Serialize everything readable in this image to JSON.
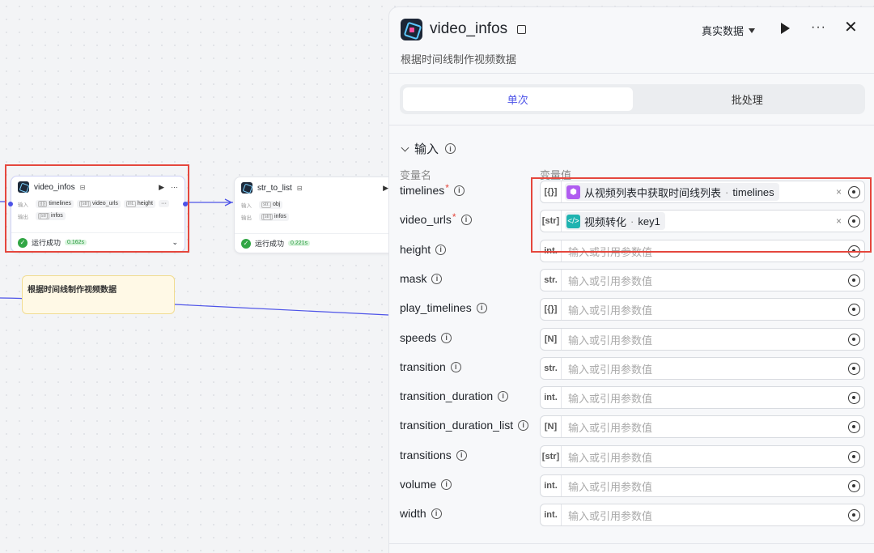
{
  "canvas": {
    "node_video": {
      "title": "video_infos",
      "input_label": "输入",
      "output_label": "输出",
      "inputs": [
        {
          "type": "[{}]",
          "name": "timelines"
        },
        {
          "type": "[str]",
          "name": "video_urls"
        },
        {
          "type": "int.",
          "name": "height"
        }
      ],
      "outputs": [
        {
          "type": "[str]",
          "name": "infos"
        }
      ],
      "status_text": "运行成功",
      "duration": "0.162s",
      "more": "···"
    },
    "node_str": {
      "title": "str_to_list",
      "input_label": "输入",
      "output_label": "输出",
      "inputs": [
        {
          "type": "str.",
          "name": "obj"
        }
      ],
      "outputs": [
        {
          "type": "[str]",
          "name": "infos"
        }
      ],
      "status_text": "运行成功",
      "duration": "0.221s"
    },
    "note": {
      "text": "根据时间线制作视频数据"
    }
  },
  "panel": {
    "title": "video_infos",
    "description": "根据时间线制作视频数据",
    "data_mode": "真实数据",
    "more": "···",
    "close": "✕",
    "tabs": [
      "单次",
      "批处理"
    ],
    "active_tab": 0,
    "section_title": "输入",
    "col_name": "变量名",
    "col_value": "变量值",
    "placeholder": "输入或引用参数值",
    "params": [
      {
        "name": "timelines",
        "required": true,
        "type": "[{}]",
        "ref": {
          "icon": "cube",
          "color": "#b05cf0",
          "label": "从视频列表中获取时间线列表",
          "sep": " · ",
          "var": "timelines"
        }
      },
      {
        "name": "video_urls",
        "required": true,
        "type": "[str]",
        "ref": {
          "icon": "code",
          "color": "#1fb3b0",
          "label": "视频转化",
          "sep": " · ",
          "var": "key1"
        }
      },
      {
        "name": "height",
        "required": false,
        "type": "int."
      },
      {
        "name": "mask",
        "required": false,
        "type": "str."
      },
      {
        "name": "play_timelines",
        "required": false,
        "type": "[{}]"
      },
      {
        "name": "speeds",
        "required": false,
        "type": "[N]"
      },
      {
        "name": "transition",
        "required": false,
        "type": "str."
      },
      {
        "name": "transition_duration",
        "required": false,
        "type": "int."
      },
      {
        "name": "transition_duration_list",
        "required": false,
        "type": "[N]"
      },
      {
        "name": "transitions",
        "required": false,
        "type": "[str]"
      },
      {
        "name": "volume",
        "required": false,
        "type": "int."
      },
      {
        "name": "width",
        "required": false,
        "type": "int."
      }
    ]
  },
  "colors": {
    "accent": "#4d53e8",
    "success": "#32a645",
    "highlight_border": "#e5473d"
  }
}
